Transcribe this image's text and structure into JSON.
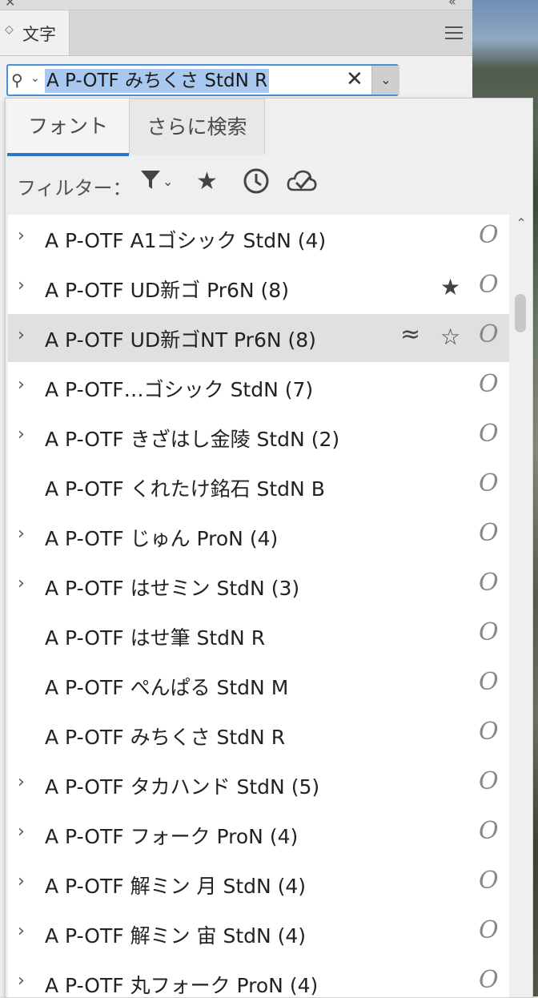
{
  "panel": {
    "tab_label": "文字",
    "search_value": "A P-OTF みちくさ StdN R",
    "clear_glyph": "✕"
  },
  "popup": {
    "tabs": [
      "フォント",
      "さらに検索"
    ],
    "filter_label": "フィルター：",
    "filter_icons": [
      "filter-funnel-icon",
      "favorites-star-icon",
      "recent-clock-icon",
      "cloud-check-icon"
    ]
  },
  "fonts": [
    {
      "name": "A P-OTF A1ゴシック StdN (4)",
      "expandable": true,
      "favorite": "",
      "similar": false,
      "selected": false
    },
    {
      "name": "A P-OTF UD新ゴ Pr6N (8)",
      "expandable": true,
      "favorite": "filled",
      "similar": false,
      "selected": false
    },
    {
      "name": "A P-OTF UD新ゴNT Pr6N (8)",
      "expandable": true,
      "favorite": "outline",
      "similar": true,
      "selected": true
    },
    {
      "name": "A P-OTF…ゴシック StdN (7)",
      "expandable": true,
      "favorite": "",
      "similar": false,
      "selected": false
    },
    {
      "name": "A P-OTF きざはし金陵 StdN (2)",
      "expandable": true,
      "favorite": "",
      "similar": false,
      "selected": false
    },
    {
      "name": "A P-OTF くれたけ銘石 StdN B",
      "expandable": false,
      "favorite": "",
      "similar": false,
      "selected": false
    },
    {
      "name": "A P-OTF じゅん ProN (4)",
      "expandable": true,
      "favorite": "",
      "similar": false,
      "selected": false
    },
    {
      "name": "A P-OTF はせミン StdN (3)",
      "expandable": true,
      "favorite": "",
      "similar": false,
      "selected": false
    },
    {
      "name": "A P-OTF はせ筆 StdN R",
      "expandable": false,
      "favorite": "",
      "similar": false,
      "selected": false
    },
    {
      "name": "A P-OTF ぺんぱる StdN M",
      "expandable": false,
      "favorite": "",
      "similar": false,
      "selected": false
    },
    {
      "name": "A P-OTF みちくさ StdN R",
      "expandable": false,
      "favorite": "",
      "similar": false,
      "selected": false
    },
    {
      "name": "A P-OTF タカハンド StdN (5)",
      "expandable": true,
      "favorite": "",
      "similar": false,
      "selected": false
    },
    {
      "name": "A P-OTF フォーク ProN (4)",
      "expandable": true,
      "favorite": "",
      "similar": false,
      "selected": false
    },
    {
      "name": "A P-OTF 解ミン 月 StdN (4)",
      "expandable": true,
      "favorite": "",
      "similar": false,
      "selected": false
    },
    {
      "name": "A P-OTF 解ミン 宙 StdN (4)",
      "expandable": true,
      "favorite": "",
      "similar": false,
      "selected": false
    },
    {
      "name": "A P-OTF 丸フォーク ProN (4)",
      "expandable": true,
      "favorite": "",
      "similar": false,
      "selected": false
    }
  ],
  "font_type_glyph": "O",
  "colors": {
    "accent": "#2b74c9",
    "selection": "#a9c8ef"
  }
}
